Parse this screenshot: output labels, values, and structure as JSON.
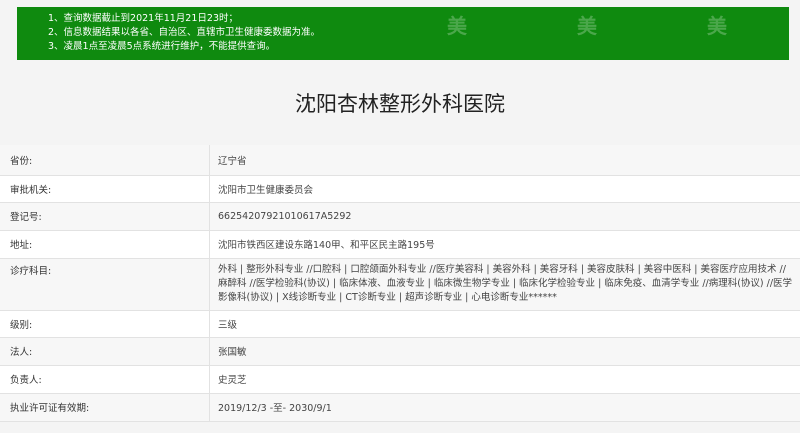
{
  "notice": {
    "lines": [
      "1、查询数据截止到2021年11月21日23时；",
      "2、信息数据结果以各省、自治区、直辖市卫生健康委数据为准。",
      "3、凌晨1点至凌晨5点系统进行维护，不能提供查询。"
    ],
    "watermark": "美"
  },
  "hospital_name": "沈阳杏林整形外科医院",
  "rows": [
    {
      "label": "省份:",
      "value": "辽宁省"
    },
    {
      "label": "审批机关:",
      "value": "沈阳市卫生健康委员会"
    },
    {
      "label": "登记号:",
      "value": "66254207921010617A5292"
    },
    {
      "label": "地址:",
      "value": "沈阳市铁西区建设东路140甲、和平区民主路195号"
    },
    {
      "label": "诊疗科目:",
      "value": "外科 | 整形外科专业 //口腔科 | 口腔颌面外科专业 //医疗美容科 | 美容外科 | 美容牙科 | 美容皮肤科 | 美容中医科 | 美容医疗应用技术 //麻醉科 //医学检验科(协议) | 临床体液、血液专业 | 临床微生物学专业 | 临床化学检验专业 | 临床免疫、血清学专业 //病理科(协议) //医学影像科(协议) | X线诊断专业 | CT诊断专业 | 超声诊断专业 | 心电诊断专业******"
    },
    {
      "label": "级别:",
      "value": "三级"
    },
    {
      "label": "法人:",
      "value": "张国敏"
    },
    {
      "label": "负责人:",
      "value": "史灵芝"
    },
    {
      "label": "执业许可证有效期:",
      "value": "2019/12/3 -至- 2030/9/1"
    }
  ]
}
